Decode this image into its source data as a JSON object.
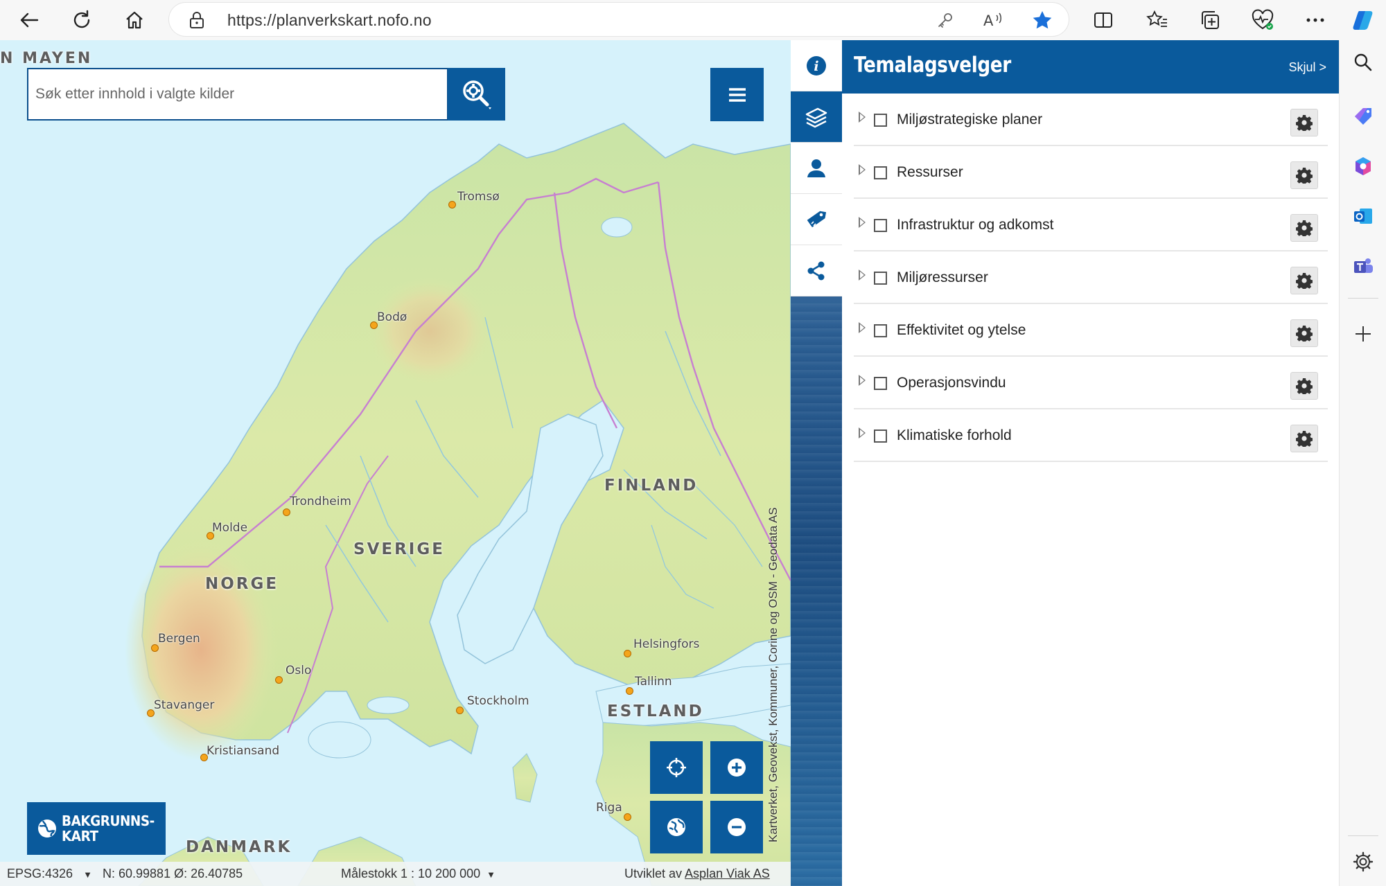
{
  "browser": {
    "url": "https://planverkskart.nofo.no"
  },
  "search": {
    "placeholder": "Søk etter innhold i valgte kilder"
  },
  "map": {
    "labels": {
      "jan_mayen": "N MAYEN",
      "norge": "NORGE",
      "sverige": "SVERIGE",
      "finland": "FINLAND",
      "estland": "ESTLAND",
      "danmark": "DANMARK",
      "tromso": "Tromsø",
      "bodo": "Bodø",
      "trondheim": "Trondheim",
      "molde": "Molde",
      "bergen": "Bergen",
      "oslo": "Oslo",
      "stavanger": "Stavanger",
      "kristiansand": "Kristiansand",
      "stockholm": "Stockholm",
      "helsingfors": "Helsingfors",
      "tallinn": "Tallinn",
      "riga": "Riga"
    },
    "attribution": "Kartverket, Geovekst, Kommuner, Corine og OSM - Geodata AS",
    "background_button": {
      "line1": "BAKGRUNNS-",
      "line2": "KART"
    }
  },
  "status_bar": {
    "projection": "EPSG:4326",
    "coordinates": "N: 60.99881 Ø: 26.40785",
    "scale": "Målestokk 1 : 10 200 000",
    "developed_by_prefix": "Utviklet av",
    "developer": "Asplan Viak AS"
  },
  "panel": {
    "title": "Temalagsvelger",
    "hide_label": "Skjul >",
    "layers": [
      {
        "label": "Miljøstrategiske planer"
      },
      {
        "label": "Ressurser"
      },
      {
        "label": "Infrastruktur og adkomst"
      },
      {
        "label": "Miljøressurser"
      },
      {
        "label": "Effektivitet og ytelse"
      },
      {
        "label": "Operasjonsvindu"
      },
      {
        "label": "Klimatiske forhold"
      }
    ]
  },
  "colors": {
    "accent": "#0a5a9c",
    "city_dot": "#f4a51c",
    "border_line": "#c77fd1"
  }
}
